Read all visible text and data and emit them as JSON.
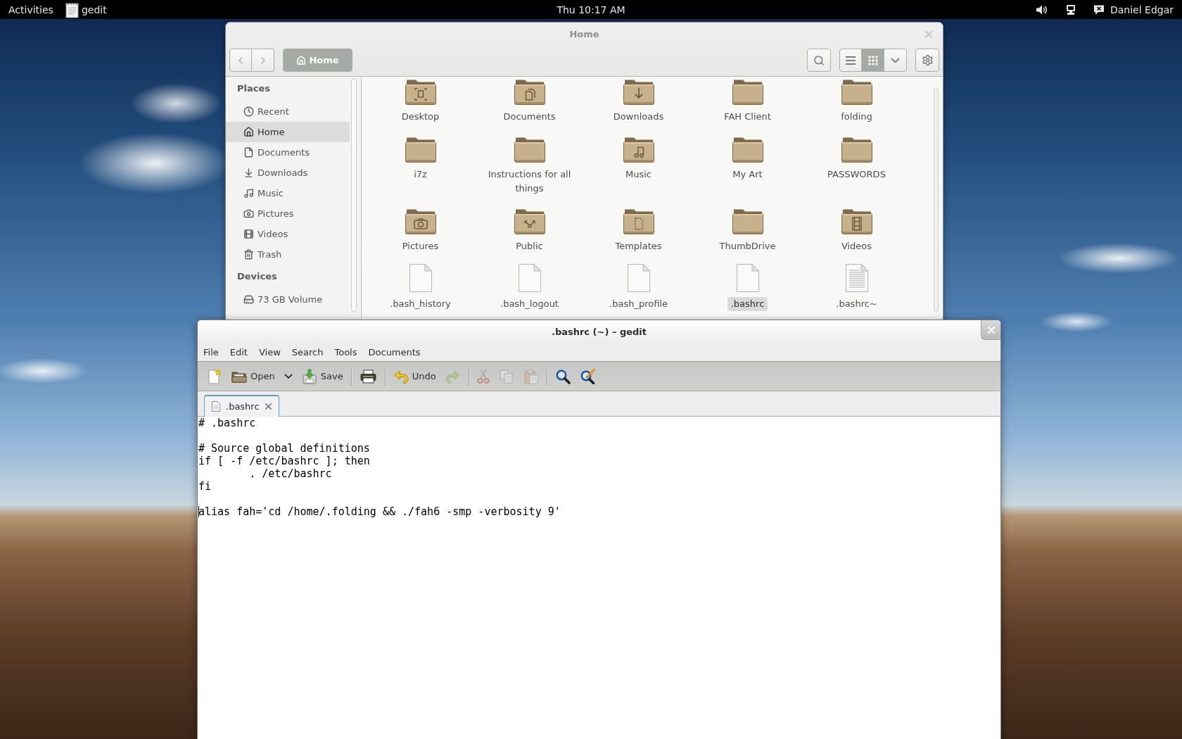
{
  "top_bar": {
    "activities": "Activities",
    "app_menu": "gedit",
    "clock": "Thu 10:17 AM",
    "user": "Daniel Edgar"
  },
  "file_manager": {
    "title": "Home",
    "path": [
      {
        "label": "Home",
        "selected": true
      }
    ],
    "view_modes": [
      {
        "kind": "list",
        "selected": false
      },
      {
        "kind": "grid",
        "selected": true
      }
    ],
    "sidebar": [
      {
        "heading": "Places",
        "items": [
          {
            "label": "Recent",
            "kind": "recent",
            "selected": false
          },
          {
            "label": "Home",
            "kind": "home",
            "selected": true
          },
          {
            "label": "Documents",
            "kind": "documents",
            "selected": false
          },
          {
            "label": "Downloads",
            "kind": "downloads",
            "selected": false
          },
          {
            "label": "Music",
            "kind": "music",
            "selected": false
          },
          {
            "label": "Pictures",
            "kind": "pictures",
            "selected": false
          },
          {
            "label": "Videos",
            "kind": "videos",
            "selected": false
          },
          {
            "label": "Trash",
            "kind": "trash",
            "selected": false
          }
        ]
      },
      {
        "heading": "Devices",
        "items": [
          {
            "label": "73 GB Volume",
            "kind": "drive",
            "selected": false
          }
        ]
      }
    ],
    "items": [
      {
        "name": "Desktop",
        "kind": "desktop",
        "selected": false
      },
      {
        "name": "Documents",
        "kind": "documents",
        "selected": false
      },
      {
        "name": "Downloads",
        "kind": "downloads",
        "selected": false
      },
      {
        "name": "FAH Client",
        "kind": "folder",
        "selected": false
      },
      {
        "name": "folding",
        "kind": "folder",
        "selected": false
      },
      {
        "name": "i7z",
        "kind": "folder",
        "selected": false
      },
      {
        "name": "Instructions for all things",
        "kind": "folder",
        "selected": false
      },
      {
        "name": "Music",
        "kind": "music",
        "selected": false
      },
      {
        "name": "My Art",
        "kind": "folder",
        "selected": false
      },
      {
        "name": "PASSWORDS",
        "kind": "folder",
        "selected": false
      },
      {
        "name": "Pictures",
        "kind": "pictures",
        "selected": false
      },
      {
        "name": "Public",
        "kind": "public",
        "selected": false
      },
      {
        "name": "Templates",
        "kind": "templates",
        "selected": false
      },
      {
        "name": "ThumbDrive",
        "kind": "folder",
        "selected": false
      },
      {
        "name": "Videos",
        "kind": "videos",
        "selected": false
      },
      {
        "name": ".bash_history",
        "kind": "file",
        "selected": false
      },
      {
        "name": ".bash_logout",
        "kind": "file",
        "selected": false
      },
      {
        "name": ".bash_profile",
        "kind": "file",
        "selected": false
      },
      {
        "name": ".bashrc",
        "kind": "file",
        "selected": true
      },
      {
        "name": ".bashrc~",
        "kind": "text",
        "selected": false
      }
    ]
  },
  "editor": {
    "title": ".bashrc (~) – gedit",
    "menu": [
      "File",
      "Edit",
      "View",
      "Search",
      "Tools",
      "Documents"
    ],
    "toolbar": [
      [
        {
          "kind": "new",
          "disabled": false
        },
        {
          "kind": "open",
          "label": "Open",
          "disabled": false
        },
        {
          "kind": "dropdown",
          "disabled": false
        },
        {
          "kind": "save",
          "label": "Save",
          "disabled": false
        }
      ],
      [
        {
          "kind": "print",
          "disabled": false
        }
      ],
      [
        {
          "kind": "undo",
          "label": "Undo",
          "disabled": false
        },
        {
          "kind": "redo",
          "disabled": true
        }
      ],
      [
        {
          "kind": "cut",
          "disabled": true
        },
        {
          "kind": "copy",
          "disabled": true
        },
        {
          "kind": "paste",
          "disabled": true
        }
      ],
      [
        {
          "kind": "find",
          "disabled": false
        },
        {
          "kind": "replace",
          "disabled": false
        }
      ]
    ],
    "tabs": [
      {
        "label": ".bashrc",
        "selected": true
      }
    ],
    "blocks": [
      {
        "lines": [
          {
            "text": "# .bashrc",
            "cursor": false
          }
        ]
      },
      {
        "lines": [
          {
            "text": "# Source global definitions",
            "cursor": false
          },
          {
            "text": "if [ -f /etc/bashrc ]; then",
            "cursor": false
          },
          {
            "text": "        . /etc/bashrc",
            "cursor": false
          },
          {
            "text": "fi",
            "cursor": false
          }
        ]
      },
      {
        "lines": [
          {
            "text": "alias fah='cd /home/.folding && ./fah6 -smp -verbosity 9'",
            "cursor": true
          }
        ]
      }
    ]
  }
}
